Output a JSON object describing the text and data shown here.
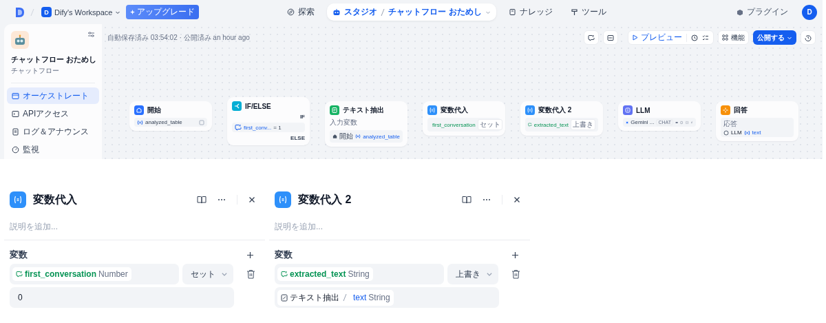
{
  "nav": {
    "workspace_initial": "D",
    "workspace": "Dify's Workspace",
    "upgrade": "アップグレード",
    "tabs": [
      {
        "label": "探索",
        "selected": false,
        "kind": "explore"
      },
      {
        "label": "スタジオ",
        "selected": true,
        "kind": "studio",
        "current_app": "チャットフロー おためし"
      },
      {
        "label": "ナレッジ",
        "selected": false,
        "kind": "knowledge"
      },
      {
        "label": "ツール",
        "selected": false,
        "kind": "tools"
      }
    ],
    "plugins": "プラグイン",
    "avatar": "D"
  },
  "sidebar": {
    "app_name": "チャットフロー おためし",
    "app_type": "チャットフロー",
    "items": [
      {
        "label": "オーケストレート",
        "selected": true,
        "kind": "orchestrate"
      },
      {
        "label": "APIアクセス",
        "selected": false,
        "kind": "api"
      },
      {
        "label": "ログ＆アナウンス",
        "selected": false,
        "kind": "logs"
      },
      {
        "label": "監視",
        "selected": false,
        "kind": "monitor"
      }
    ]
  },
  "toolbar": {
    "status": "自動保存済み 03:54:02 · 公開済み an hour ago",
    "preview": "プレビュー",
    "features": "機能",
    "publish": "公開する"
  },
  "nodes": [
    {
      "kind": "start",
      "title": "開始",
      "var": "analyzed_table"
    },
    {
      "kind": "if_else",
      "title": "IF/ELSE",
      "if_label": "IF",
      "condition_var": "first_conv...",
      "condition": "= 1",
      "else_label": "ELSE"
    },
    {
      "kind": "extract",
      "title": "テキスト抽出",
      "input_label": "入力変数",
      "source": "開始",
      "var": "analyzed_table"
    },
    {
      "kind": "assign",
      "title": "変数代入",
      "var": "first_conversation",
      "op": "セット"
    },
    {
      "kind": "assign",
      "title": "変数代入 2",
      "var": "extracted_text",
      "op": "上書き"
    },
    {
      "kind": "llm",
      "title": "LLM",
      "model": "Gemini ...",
      "mode": "CHAT"
    },
    {
      "kind": "answer",
      "title": "回答",
      "label": "応答",
      "source": "LLM",
      "var": "text"
    }
  ],
  "panels": [
    {
      "title": "変数代入",
      "description_placeholder": "説明を追加...",
      "section": "変数",
      "var": "first_conversation",
      "type": "Number",
      "op": "セット",
      "value": {
        "kind": "constant",
        "text": "0"
      }
    },
    {
      "title": "変数代入 2",
      "description_placeholder": "説明を追加...",
      "section": "変数",
      "var": "extracted_text",
      "type": "String",
      "op": "上書き",
      "value": {
        "kind": "reference",
        "source": "テキスト抽出",
        "var": "text",
        "type": "String"
      }
    }
  ]
}
